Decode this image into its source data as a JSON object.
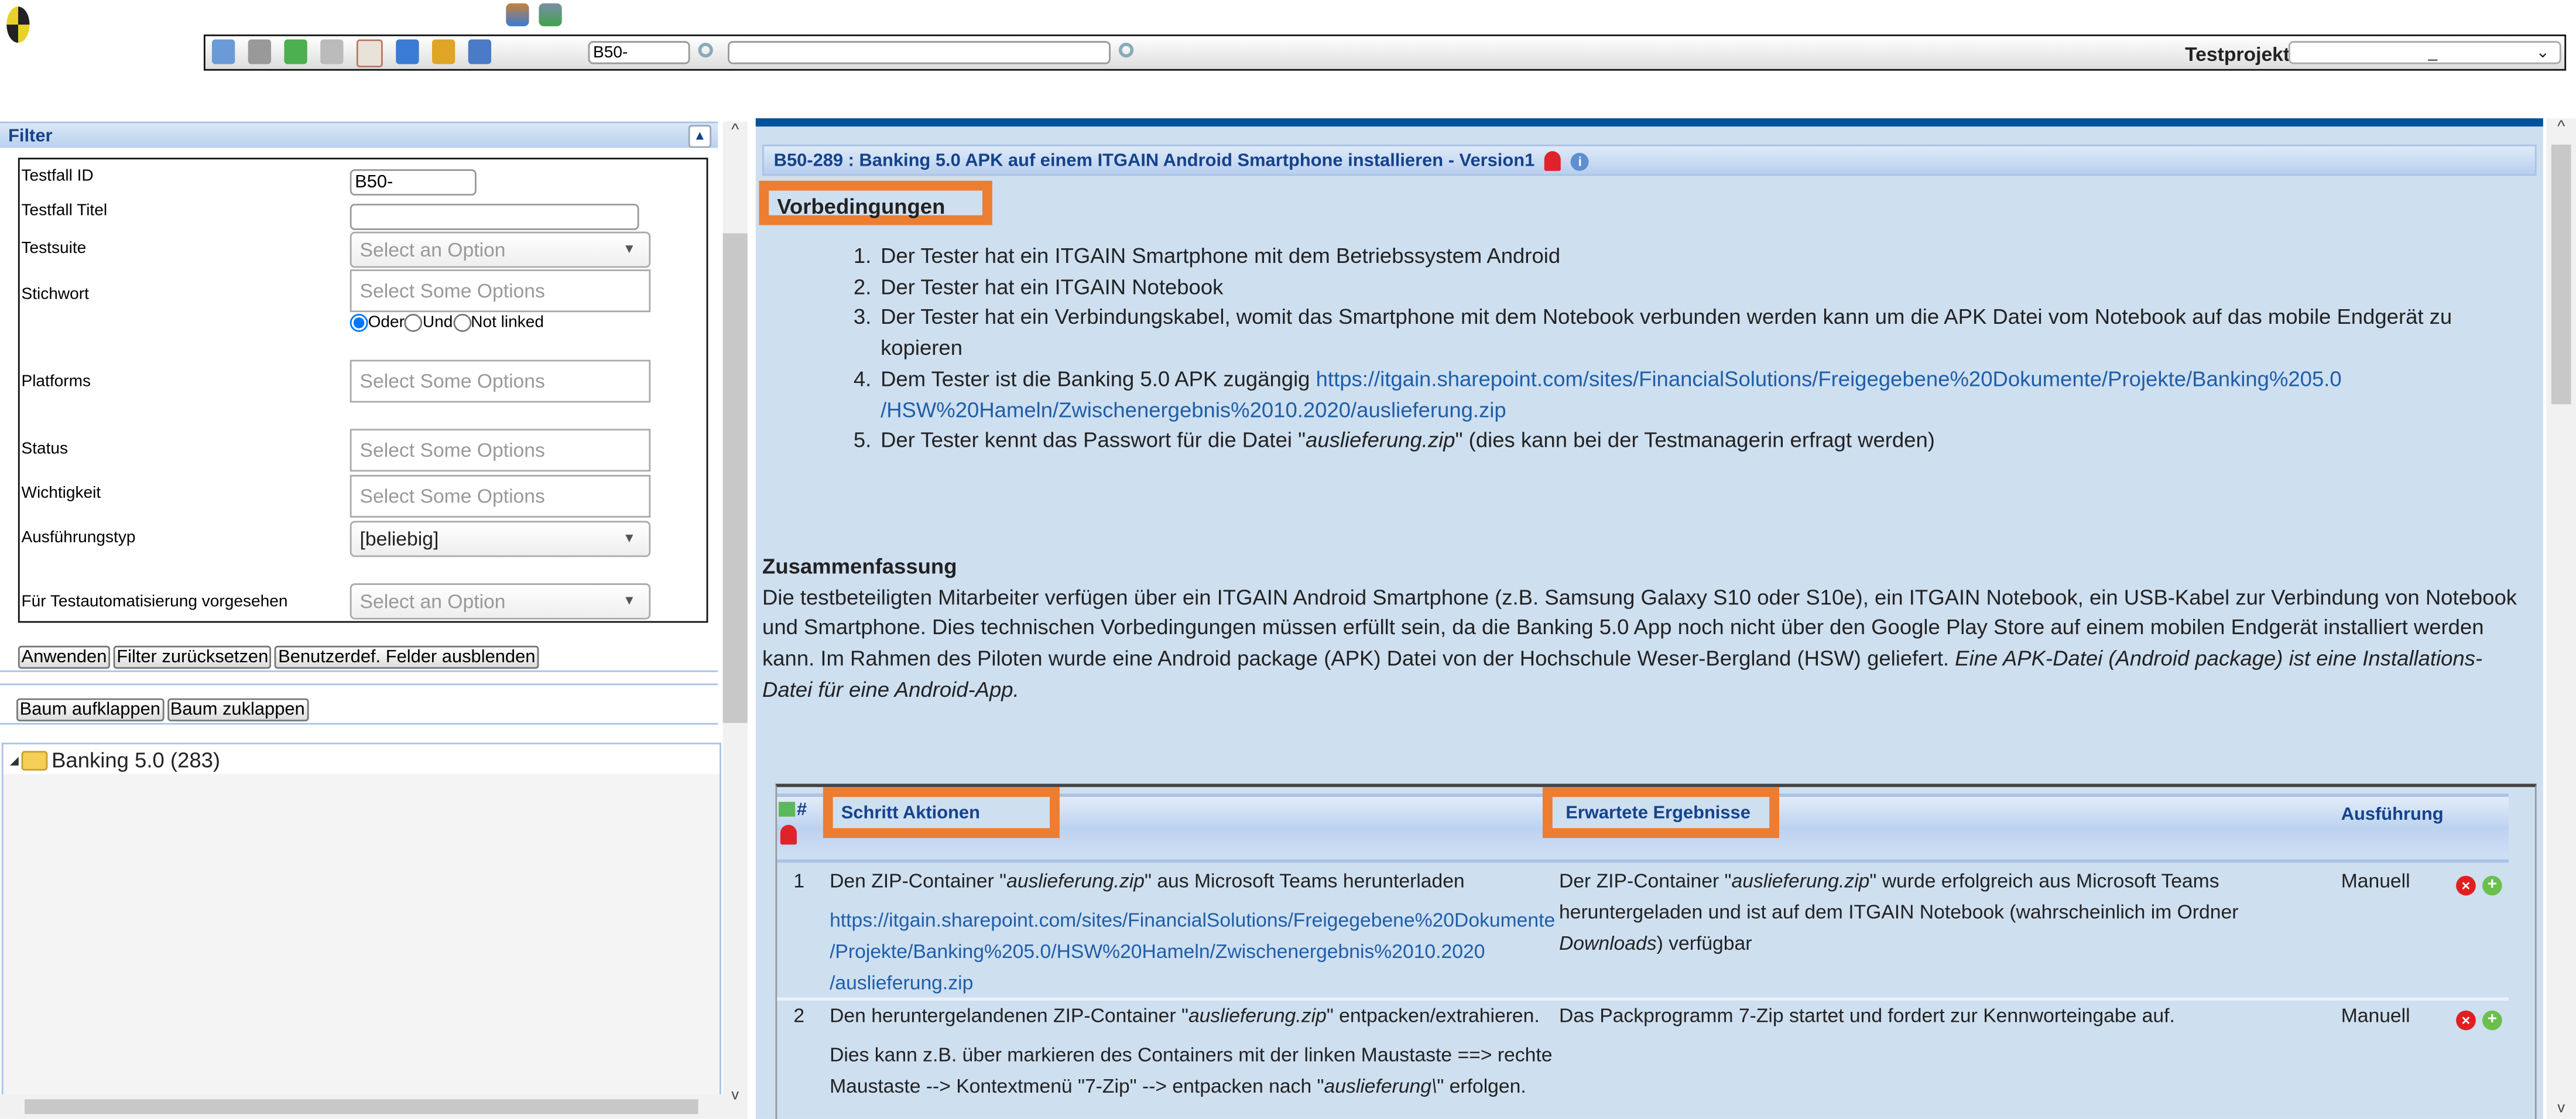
{
  "header": {
    "logo": "testlink-logo",
    "top_icons": [
      "user-edit-icon",
      "desktop-settings-icon"
    ],
    "toolbar_icons": [
      "home-icon",
      "cart-icon",
      "tree-icon",
      "chart-icon",
      "document-icon",
      "user-icon",
      "bell-icon",
      "pen-icon"
    ],
    "testcase_id_value": "B50-",
    "search_value": "",
    "testproject_label": "Testprojekt",
    "testproject_value": "_"
  },
  "filter": {
    "title": "Filter",
    "fields": [
      {
        "label": "Testfall ID",
        "value": "B50-"
      },
      {
        "label": "Testfall Titel",
        "value": ""
      },
      {
        "label": "Testsuite",
        "placeholder": "Select an Option"
      },
      {
        "label": "Stichwort",
        "placeholder": "Select Some Options"
      },
      {
        "label": "Platforms",
        "placeholder": "Select Some Options"
      },
      {
        "label": "Status",
        "placeholder": "Select Some Options"
      },
      {
        "label": "Wichtigkeit",
        "placeholder": "Select Some Options"
      },
      {
        "label": "Ausführungstyp",
        "value": "[beliebig]"
      },
      {
        "label": "Für Testautomatisierung vorgesehen",
        "placeholder": "Select an Option"
      }
    ],
    "radio": [
      {
        "label": "Oder",
        "checked": true
      },
      {
        "label": "Und",
        "checked": false
      },
      {
        "label": "Not linked",
        "checked": false
      }
    ],
    "buttons": {
      "apply": "Anwenden",
      "reset": "Filter zurücksetzen",
      "hide_custom": "Benutzerdef. Felder ausblenden"
    }
  },
  "tree": {
    "expand": "Baum aufklappen",
    "collapse": "Baum zuklappen",
    "root": "Banking 5.0 (283)"
  },
  "testcase": {
    "title": "B50-289 : Banking 5.0 APK auf einem ITGAIN Android Smartphone installieren - Version1",
    "preconditions_heading": "Vorbedingungen",
    "preconditions": [
      {
        "text": "Der Tester hat ein ITGAIN Smartphone mit dem Betriebssystem Android"
      },
      {
        "text": "Der Tester hat ein ITGAIN Notebook"
      },
      {
        "text": "Der Tester hat ein Verbindungskabel, womit das Smartphone mit dem Notebook verbunden werden kann um die APK Datei vom Notebook auf das mobile Endgerät zu kopieren"
      },
      {
        "text": "Dem Tester ist die Banking 5.0 APK zugängig ",
        "link": "https://itgain.sharepoint.com/sites/FinancialSolutions/Freigegebene%20Dokumente/Projekte/Banking%205.0 /HSW%20Hameln/Zwischenergebnis%2010.2020/auslieferung.zip"
      },
      {
        "text": "Der Tester kennt das Passwort für die Datei \"",
        "em": "auslieferung.zip",
        "after": "\" (dies kann bei der Testmanagerin erfragt werden)"
      }
    ],
    "summary_heading": "Zusammenfassung",
    "summary": "Die testbeteiligten Mitarbeiter verfügen über ein ITGAIN Android Smartphone (z.B. Samsung Galaxy S10 oder S10e), ein ITGAIN Notebook, ein USB-Kabel zur Verbindung von Notebook und Smartphone. Dies technischen Vorbedingungen müssen erfüllt sein, da die Banking 5.0 App noch nicht über den Google Play Store auf einem mobilen Endgerät installiert werden kann. Im Rahmen des Piloten wurde eine Android package (APK) Datei von der Hochschule Weser-Bergland (HSW) geliefert. ",
    "summary_em": "Eine APK-Datei (Android package) ist eine Installations-Datei für eine Android-App.",
    "steps_header": {
      "num": "#",
      "actions": "Schritt Aktionen",
      "expected": "Erwartete Ergebnisse",
      "execution": "Ausführung"
    },
    "steps": [
      {
        "num": "1",
        "action_a": "Den ZIP-Container \"",
        "action_em": "auslieferung.zip",
        "action_b": "\" aus Microsoft Teams herunterladen",
        "action_link": "https://itgain.sharepoint.com/sites/FinancialSolutions/Freigegebene%20Dokumente /Projekte/Banking%205.0/HSW%20Hameln/Zwischenergebnis%2010.2020 /auslieferung.zip",
        "expected_a": "Der ZIP-Container \"",
        "expected_em": "auslieferung.zip",
        "expected_b": "\" wurde erfolgreich aus Microsoft Teams heruntergeladen und ist auf dem ITGAIN Notebook (wahrscheinlich im Ordner ",
        "expected_em2": "Downloads",
        "expected_c": ") verfügbar",
        "execution": "Manuell"
      },
      {
        "num": "2",
        "action_a": "Den heruntergelandenen ZIP-Container \"",
        "action_em": "auslieferung.zip",
        "action_b": "\" entpacken/extrahieren.",
        "action_p2a": "Dies kann z.B. über markieren des Containers mit der linken Maustaste ==> rechte Maustaste --> Kontextmenü \"7-Zip\" --> entpacken nach \"",
        "action_p2em": "auslieferung\\",
        "action_p2b": "\" erfolgen.",
        "expected_a": "Das Packprogramm 7-Zip startet und fordert zur Kennworteingabe auf.",
        "execution": "Manuell"
      }
    ]
  },
  "colors": {
    "accent": "#00539b",
    "panel": "#cedff0",
    "highlight": "#ed7d31",
    "header_text": "#15428b",
    "link": "#1f5ea8"
  }
}
